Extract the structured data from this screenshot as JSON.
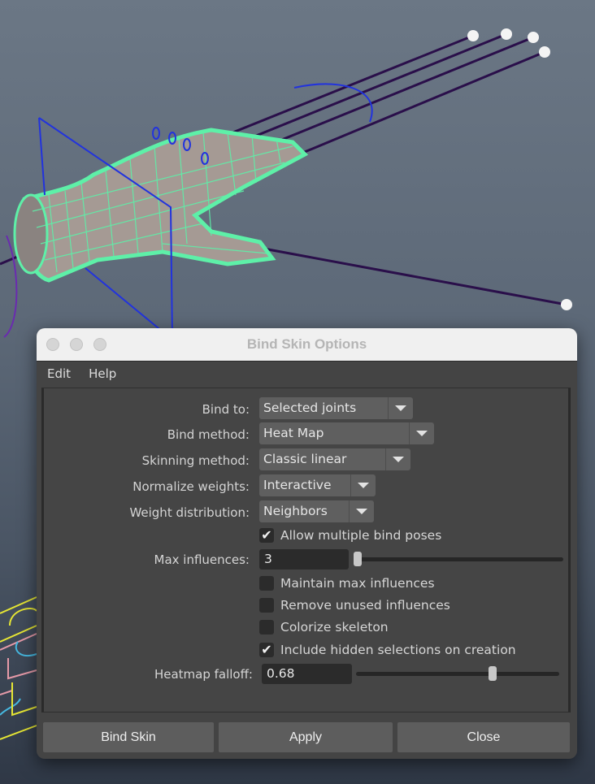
{
  "window": {
    "title": "Bind Skin Options"
  },
  "menu": {
    "items": [
      {
        "label": "Edit"
      },
      {
        "label": "Help"
      }
    ]
  },
  "options": {
    "bind_to": {
      "label": "Bind to:",
      "value": "Selected joints"
    },
    "bind_method": {
      "label": "Bind method:",
      "value": "Heat Map"
    },
    "skinning_method": {
      "label": "Skinning method:",
      "value": "Classic linear"
    },
    "normalize_weights": {
      "label": "Normalize weights:",
      "value": "Interactive"
    },
    "weight_distribution": {
      "label": "Weight distribution:",
      "value": "Neighbors"
    },
    "allow_multiple_bind_poses": {
      "label": "Allow multiple bind poses",
      "checked": true,
      "mark": "✔"
    },
    "max_influences": {
      "label": "Max influences:",
      "value": "3",
      "slider_fraction": 0.0
    },
    "maintain_max_influences": {
      "label": "Maintain max influences",
      "checked": false
    },
    "remove_unused_influences": {
      "label": "Remove unused influences",
      "checked": false
    },
    "colorize_skeleton": {
      "label": "Colorize skeleton",
      "checked": false
    },
    "include_hidden_selections": {
      "label": "Include hidden selections on creation",
      "checked": true,
      "mark": "✔"
    },
    "heatmap_falloff": {
      "label": "Heatmap falloff:",
      "value": "0.68",
      "slider_fraction": 0.68
    }
  },
  "buttons": {
    "bind_skin": "Bind Skin",
    "apply": "Apply",
    "close": "Close"
  },
  "viewport": {
    "mesh_color": "#5ef0a8",
    "joint_color": "#2a0f4a",
    "control_color": "#2233dd"
  }
}
